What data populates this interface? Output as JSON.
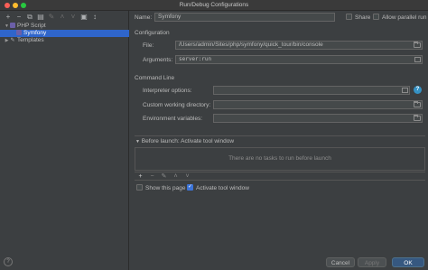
{
  "window": {
    "title": "Run/Debug Configurations"
  },
  "toolbar": {
    "icons": [
      "add-icon",
      "remove-icon",
      "copy-icon",
      "save-icon",
      "edit-icon",
      "move-up-icon",
      "move-down-icon",
      "folder-icon",
      "sort-icon"
    ],
    "glyphs": [
      "+",
      "−",
      "⧉",
      "▤",
      "✎",
      "˄",
      "˅",
      "▣",
      "↕"
    ]
  },
  "tree": {
    "items": [
      {
        "label": "PHP Script",
        "arrow": "▼"
      },
      {
        "label": "Symfony"
      },
      {
        "label": "Templates",
        "arrow": "▶"
      }
    ]
  },
  "form": {
    "name_label": "Name:",
    "name_value": "Symfony",
    "share_label": "Share",
    "allow_parallel_label": "Allow parallel run",
    "configuration_title": "Configuration",
    "file_label": "File:",
    "file_value": "/Users/admin/Sites/php/symfony/quick_tour/bin/console",
    "arguments_label": "Arguments:",
    "arguments_value": "server:run",
    "command_line_title": "Command Line",
    "interpreter_options_label": "Interpreter options:",
    "working_dir_label": "Custom working directory:",
    "env_vars_label": "Environment variables:",
    "help_glyph": "?"
  },
  "before_launch": {
    "title": "Before launch: Activate tool window",
    "arrow": "▼",
    "empty_text": "There are no tasks to run before launch",
    "toolbar_glyphs": [
      "+",
      "−",
      "✎",
      "˄",
      "˅"
    ]
  },
  "options": {
    "show_page_label": "Show this page",
    "activate_tool_window_label": "Activate tool window"
  },
  "buttons": {
    "help": "?",
    "cancel": "Cancel",
    "apply": "Apply",
    "ok": "OK"
  },
  "colors": {
    "selection": "#2f65ca",
    "primary_button": "#365880",
    "help_icon": "#3592c4"
  }
}
